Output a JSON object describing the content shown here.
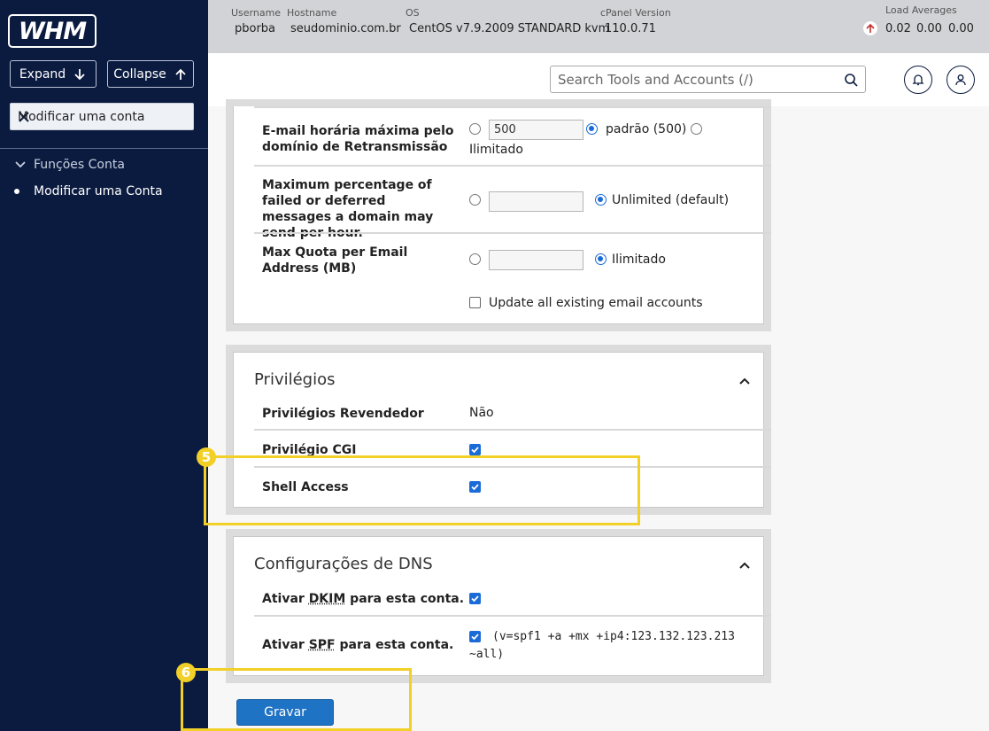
{
  "sidebar": {
    "logo": "WHM",
    "expand_label": "Expand",
    "collapse_label": "Collapse",
    "filter_value": "Modificar uma conta",
    "category": "Funções Conta",
    "item": "Modificar uma Conta"
  },
  "topbar": {
    "username_label": "Username",
    "username": "pborba",
    "hostname_label": "Hostname",
    "hostname": "seudominio.com.br",
    "os_label": "OS",
    "os": "CentOS v7.9.2009 STANDARD kvm",
    "cpanel_label": "cPanel Version",
    "cpanel": "110.0.71",
    "load_label": "Load Averages",
    "load": [
      "0.02",
      "0.00",
      "0.00"
    ]
  },
  "header": {
    "search_placeholder": "Search Tools and Accounts (/)"
  },
  "email_panel": {
    "relay_label": "E-mail horária máxima pelo domínio de Retransmissão",
    "relay_value": "500",
    "relay_default": "padrão (500)",
    "relay_unlimited": "Ilimitado",
    "failed_label": "Maximum percentage of failed or deferred messages a domain may send per hour.",
    "failed_default": "Unlimited (default)",
    "quota_label": "Max Quota per Email Address (MB)",
    "quota_unlimited": "Ilimitado",
    "update_label": "Update all existing email accounts"
  },
  "privileges": {
    "title": "Privilégios",
    "reseller_label": "Privilégios Revendedor",
    "reseller_value": "Não",
    "cgi_label": "Privilégio CGI",
    "shell_label": "Shell Access"
  },
  "dns": {
    "title": "Configurações de DNS",
    "dkim_prefix": "Ativar ",
    "dkim_abbr": "DKIM",
    "dkim_suffix": " para esta conta.",
    "spf_prefix": "Ativar ",
    "spf_abbr": "SPF",
    "spf_suffix": " para esta conta.",
    "spf_record_line1": "(v=spf1 +a +mx +ip4:123.132.123.213",
    "spf_record_line2": "~all)"
  },
  "save_label": "Gravar",
  "annotations": [
    "5",
    "6"
  ],
  "colors": {
    "sidebar": "#0b1b3f",
    "accent": "#1a6bd6",
    "highlight": "#f2d027",
    "button": "#1f73c4"
  }
}
